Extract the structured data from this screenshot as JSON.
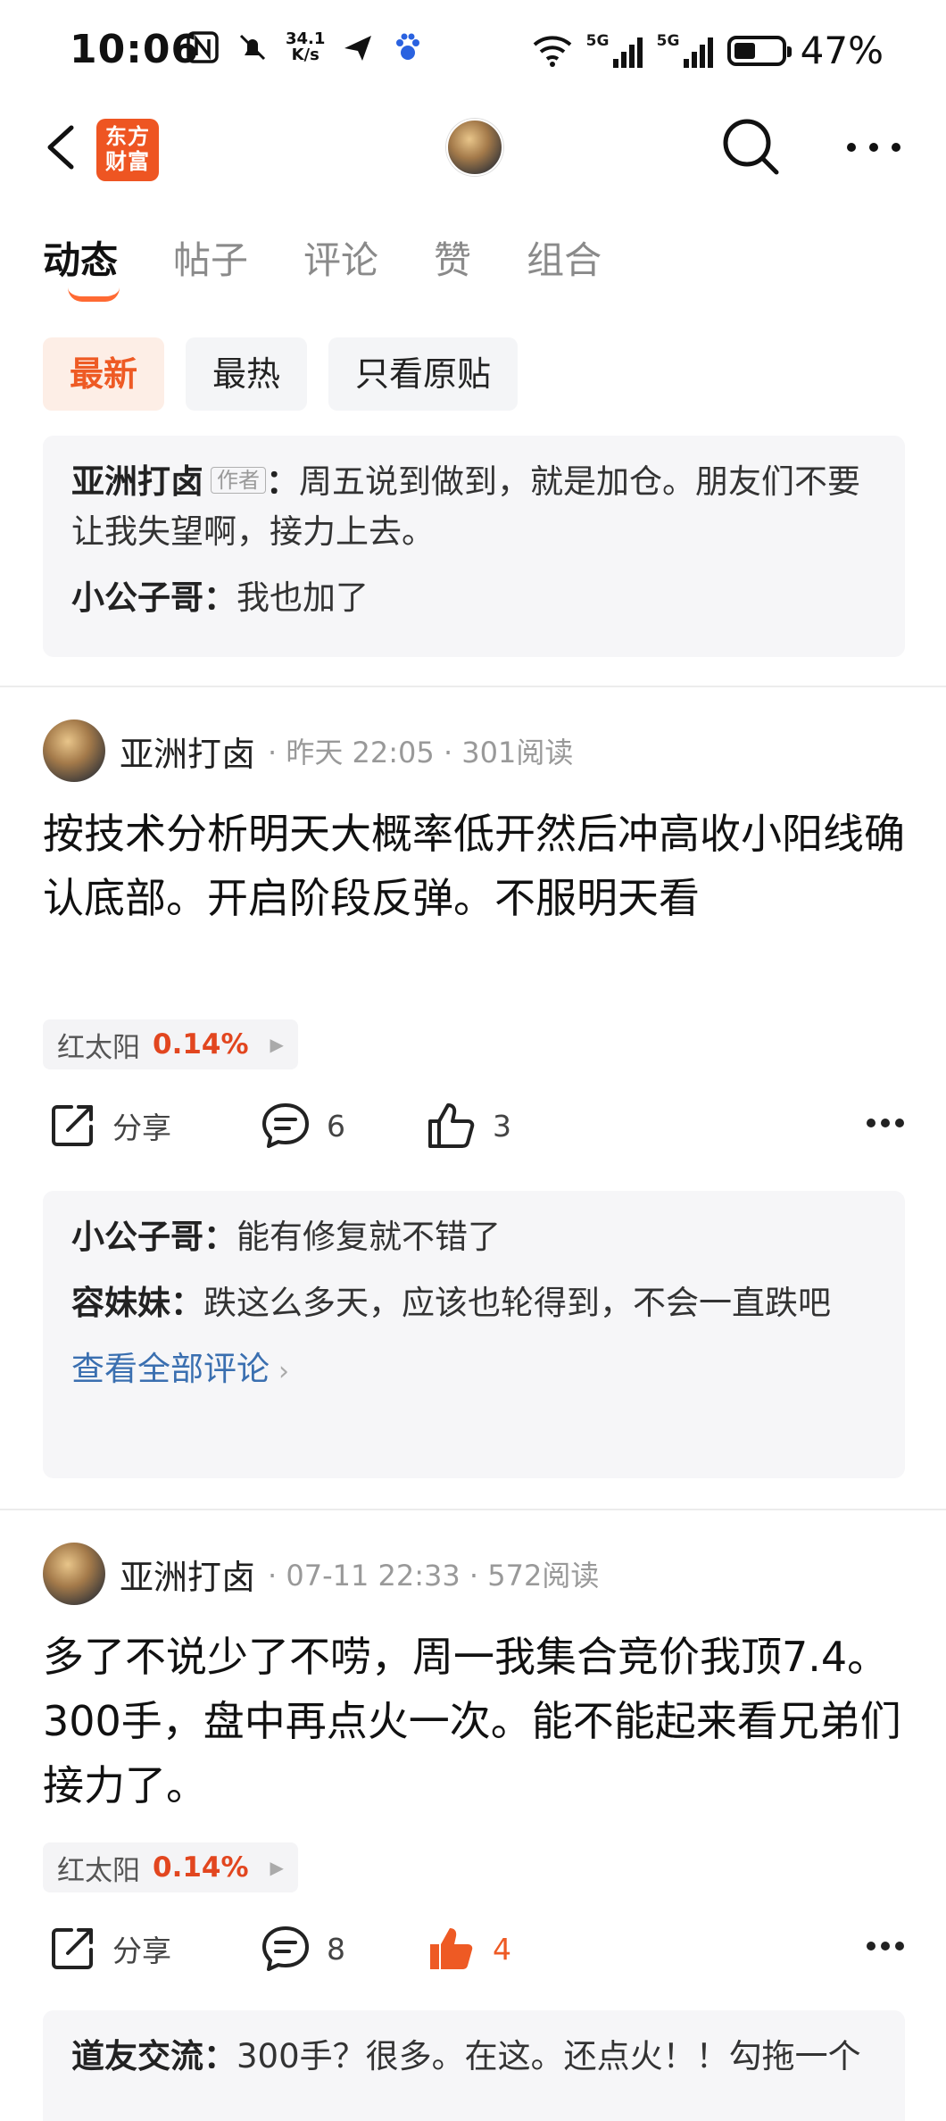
{
  "status": {
    "time": "10:06",
    "speed": "34.1",
    "speed_unit": "K/s",
    "net1": "5G",
    "net2": "5G",
    "battery": "47%"
  },
  "header": {
    "logo_line1": "东方",
    "logo_line2": "财富"
  },
  "tabs": [
    {
      "label": "动态"
    },
    {
      "label": "帖子"
    },
    {
      "label": "评论"
    },
    {
      "label": "赞"
    },
    {
      "label": "组合"
    }
  ],
  "filters": [
    {
      "label": "最新"
    },
    {
      "label": "最热"
    },
    {
      "label": "只看原贴"
    }
  ],
  "top_comments": {
    "c1_name": "亚洲打卤",
    "c1_tag": "作者",
    "c1_text": "周五说到做到，就是加仓。朋友们不要让我失望啊，接力上去。",
    "c2_name": "小公子哥",
    "c2_text": "我也加了"
  },
  "posts": [
    {
      "author": "亚洲打卤",
      "time": "昨天 22:05",
      "reads": "301阅读",
      "text": "按技术分析明天大概率低开然后冲高收小阳线确认底部。开启阶段反弹。不服明天看",
      "stock_name": "红太阳",
      "stock_pct": "0.14%",
      "share_label": "分享",
      "comment_count": "6",
      "like_count": "3",
      "comments": [
        {
          "name": "小公子哥",
          "text": "能有修复就不错了"
        },
        {
          "name": "容妹妹",
          "text": "跌这么多天，应该也轮得到，不会一直跌吧"
        }
      ],
      "view_all": "查看全部评论"
    },
    {
      "author": "亚洲打卤",
      "time": "07-11 22:33",
      "reads": "572阅读",
      "text": "多了不说少了不唠，周一我集合竞价我顶7.4。300手，盘中再点火一次。能不能起来看兄弟们接力了。",
      "stock_name": "红太阳",
      "stock_pct": "0.14%",
      "share_label": "分享",
      "comment_count": "8",
      "like_count": "4",
      "comments": [
        {
          "name": "道友交流",
          "text": "300手？很多。在这。还点火！！勾拖一个"
        }
      ]
    }
  ],
  "colors": {
    "accent": "#ee5a24",
    "link": "#3a6fb0"
  },
  "icons": [
    "back-arrow-icon",
    "search-icon",
    "more-icon",
    "share-icon",
    "comment-icon",
    "like-icon"
  ]
}
